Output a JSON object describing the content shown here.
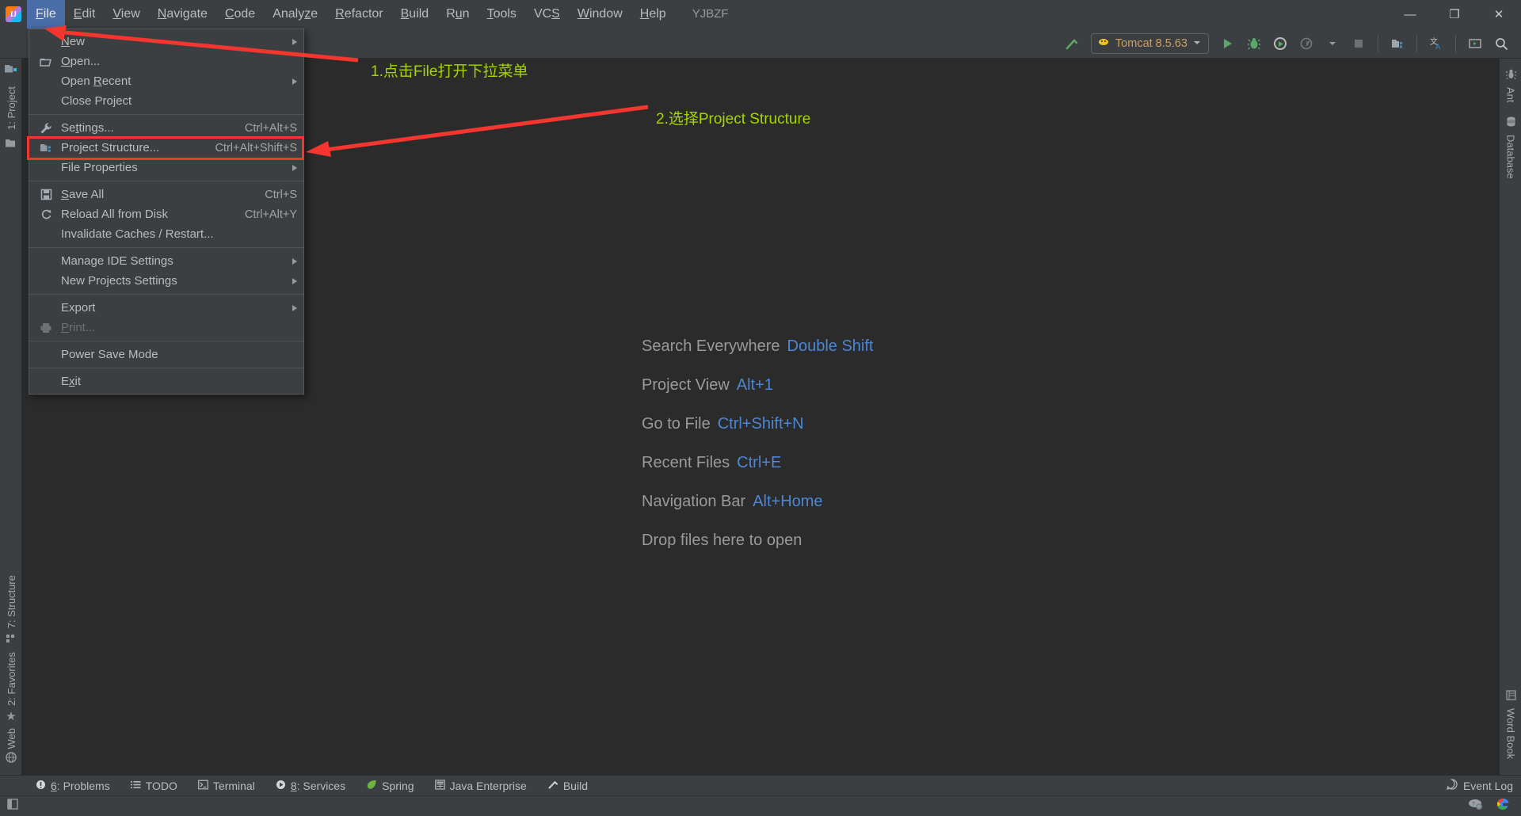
{
  "window": {
    "title": "YJBZF",
    "controls": {
      "minimize": "—",
      "maximize": "❐",
      "close": "✕"
    }
  },
  "menubar": {
    "items": [
      {
        "label": "File",
        "mnemonic": "F",
        "active": true
      },
      {
        "label": "Edit",
        "mnemonic": "E",
        "active": false
      },
      {
        "label": "View",
        "mnemonic": "V",
        "active": false
      },
      {
        "label": "Navigate",
        "mnemonic": "N",
        "active": false
      },
      {
        "label": "Code",
        "mnemonic": "C",
        "active": false
      },
      {
        "label": "Analyze",
        "mnemonic": "z",
        "active": false
      },
      {
        "label": "Refactor",
        "mnemonic": "R",
        "active": false
      },
      {
        "label": "Build",
        "mnemonic": "B",
        "active": false
      },
      {
        "label": "Run",
        "mnemonic": "u",
        "active": false
      },
      {
        "label": "Tools",
        "mnemonic": "T",
        "active": false
      },
      {
        "label": "VCS",
        "mnemonic": "S",
        "active": false
      },
      {
        "label": "Window",
        "mnemonic": "W",
        "active": false
      },
      {
        "label": "Help",
        "mnemonic": "H",
        "active": false
      }
    ]
  },
  "file_menu": {
    "rows": [
      {
        "type": "item",
        "label": "New",
        "mnemonic": "N",
        "icon": "none",
        "shortcut": "",
        "submenu": true,
        "disabled": false
      },
      {
        "type": "item",
        "label": "Open...",
        "mnemonic": "O",
        "icon": "folder-open-icon",
        "shortcut": "",
        "submenu": false,
        "disabled": false
      },
      {
        "type": "item",
        "label": "Open Recent",
        "mnemonic": "R",
        "icon": "none",
        "shortcut": "",
        "submenu": true,
        "disabled": false
      },
      {
        "type": "item",
        "label": "Close Project",
        "mnemonic": "",
        "icon": "none",
        "shortcut": "",
        "submenu": false,
        "disabled": false
      },
      {
        "type": "separator"
      },
      {
        "type": "item",
        "label": "Settings...",
        "mnemonic": "t",
        "icon": "wrench-icon",
        "shortcut": "Ctrl+Alt+S",
        "submenu": false,
        "disabled": false
      },
      {
        "type": "item",
        "label": "Project Structure...",
        "mnemonic": "",
        "icon": "project-structure-icon",
        "shortcut": "Ctrl+Alt+Shift+S",
        "submenu": false,
        "disabled": false,
        "highlighted": true
      },
      {
        "type": "item",
        "label": "File Properties",
        "mnemonic": "",
        "icon": "none",
        "shortcut": "",
        "submenu": true,
        "disabled": false
      },
      {
        "type": "separator"
      },
      {
        "type": "item",
        "label": "Save All",
        "mnemonic": "S",
        "icon": "save-icon",
        "shortcut": "Ctrl+S",
        "submenu": false,
        "disabled": false
      },
      {
        "type": "item",
        "label": "Reload All from Disk",
        "mnemonic": "",
        "icon": "reload-icon",
        "shortcut": "Ctrl+Alt+Y",
        "submenu": false,
        "disabled": false
      },
      {
        "type": "item",
        "label": "Invalidate Caches / Restart...",
        "mnemonic": "",
        "icon": "none",
        "shortcut": "",
        "submenu": false,
        "disabled": false
      },
      {
        "type": "separator"
      },
      {
        "type": "item",
        "label": "Manage IDE Settings",
        "mnemonic": "",
        "icon": "none",
        "shortcut": "",
        "submenu": true,
        "disabled": false
      },
      {
        "type": "item",
        "label": "New Projects Settings",
        "mnemonic": "",
        "icon": "none",
        "shortcut": "",
        "submenu": true,
        "disabled": false
      },
      {
        "type": "separator"
      },
      {
        "type": "item",
        "label": "Export",
        "mnemonic": "",
        "icon": "none",
        "shortcut": "",
        "submenu": true,
        "disabled": false
      },
      {
        "type": "item",
        "label": "Print...",
        "mnemonic": "P",
        "icon": "printer-icon",
        "shortcut": "",
        "submenu": false,
        "disabled": true
      },
      {
        "type": "separator"
      },
      {
        "type": "item",
        "label": "Power Save Mode",
        "mnemonic": "",
        "icon": "none",
        "shortcut": "",
        "submenu": false,
        "disabled": false
      },
      {
        "type": "separator"
      },
      {
        "type": "item",
        "label": "Exit",
        "mnemonic": "x",
        "icon": "none",
        "shortcut": "",
        "submenu": false,
        "disabled": false
      }
    ]
  },
  "toolbar": {
    "build_icon": "hammer-icon",
    "run_config": {
      "label": "Tomcat 8.5.63",
      "icon": "tomcat-cat-icon",
      "chevron": "chevron-down-icon"
    },
    "buttons": [
      {
        "name": "run-button",
        "icon": "play-icon"
      },
      {
        "name": "debug-button",
        "icon": "bug-icon"
      },
      {
        "name": "run-with-coverage-button",
        "icon": "run-coverage-icon"
      },
      {
        "name": "profile-button",
        "icon": "profiler-icon"
      },
      {
        "name": "stop-button",
        "icon": "stop-icon"
      },
      {
        "name": "project-structure-button",
        "icon": "project-structure-icon"
      },
      {
        "name": "translate-button",
        "icon": "translate-icon"
      },
      {
        "name": "presentation-button",
        "icon": "screen-icon"
      },
      {
        "name": "search-button",
        "icon": "search-icon"
      }
    ]
  },
  "left_strip": {
    "items": [
      {
        "label": "1: Project",
        "mnemonic": "1",
        "icon": "project-icon"
      },
      {
        "label": "",
        "icon": "folder-icon"
      },
      {
        "label": "7: Structure",
        "mnemonic": "7",
        "icon": "structure-icon"
      },
      {
        "label": "2: Favorites",
        "mnemonic": "2",
        "icon": "star-icon"
      },
      {
        "label": "Web",
        "mnemonic": "",
        "icon": "web-icon"
      }
    ]
  },
  "right_strip": {
    "items": [
      {
        "label": "Ant",
        "icon": "ant-icon"
      },
      {
        "label": "Database",
        "icon": "database-icon"
      },
      {
        "label": "Word Book",
        "icon": "wordbook-icon"
      }
    ]
  },
  "editor": {
    "hints": [
      {
        "label": "Search Everywhere",
        "key": "Double Shift"
      },
      {
        "label": "Project View",
        "key": "Alt+1"
      },
      {
        "label": "Go to File",
        "key": "Ctrl+Shift+N"
      },
      {
        "label": "Recent Files",
        "key": "Ctrl+E"
      },
      {
        "label": "Navigation Bar",
        "key": "Alt+Home"
      },
      {
        "label": "Drop files here to open",
        "key": ""
      }
    ]
  },
  "annotations": [
    {
      "id": "anno-1",
      "text": "1.点击File打开下拉菜单",
      "color": "#a6d400"
    },
    {
      "id": "anno-2",
      "text": "2.选择Project Structure",
      "color": "#a6d400"
    }
  ],
  "highlight_color": "#f4362e",
  "statusbar": {
    "items": [
      {
        "label": "6: Problems",
        "mnemonic": "6",
        "icon": "error-icon"
      },
      {
        "label": "TODO",
        "mnemonic": "",
        "icon": "todo-icon"
      },
      {
        "label": "Terminal",
        "mnemonic": "",
        "icon": "terminal-icon"
      },
      {
        "label": "8: Services",
        "mnemonic": "8",
        "icon": "services-icon"
      },
      {
        "label": "Spring",
        "mnemonic": "",
        "icon": "spring-leaf-icon"
      },
      {
        "label": "Java Enterprise",
        "mnemonic": "",
        "icon": "java-ee-icon"
      },
      {
        "label": "Build",
        "mnemonic": "",
        "icon": "hammer-icon"
      }
    ],
    "event_log": {
      "label": "Event Log",
      "icon": "event-log-icon"
    }
  },
  "bottombar": {
    "left_icon": "window-icon",
    "tray": [
      {
        "name": "cloud-settings-icon"
      },
      {
        "name": "google-icon"
      }
    ]
  }
}
